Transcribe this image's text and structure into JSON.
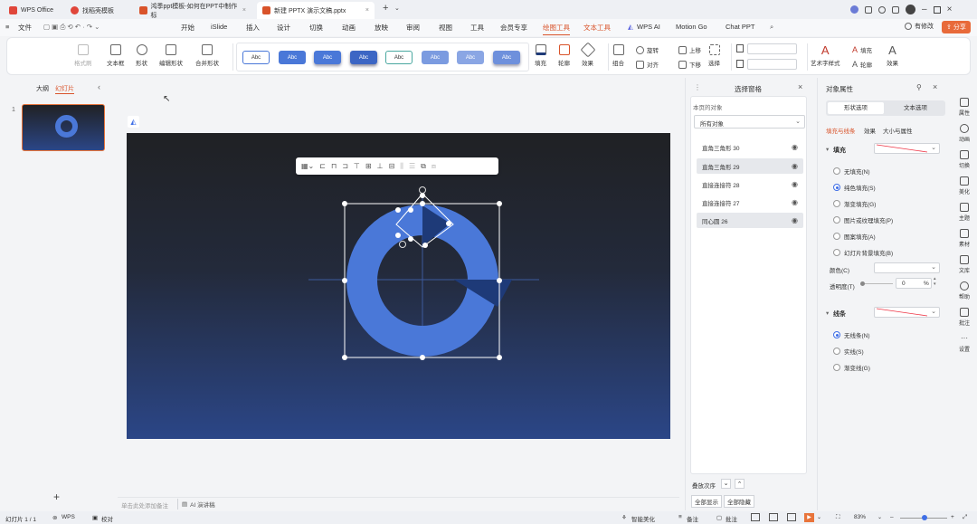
{
  "titlebar": {
    "tabs": [
      {
        "label": "WPS Office",
        "color": "#e0463a"
      },
      {
        "label": "找稻壳模板",
        "color": "#e0463a"
      },
      {
        "label": "鸿季ppt模板-如何在PPT中制作标",
        "color": "#d9532a"
      },
      {
        "label": "新建 PPTX 演示文稿.pptx",
        "color": "#d9532a"
      }
    ],
    "new_tab": "+",
    "user_status": "有修改",
    "share_label": "分享"
  },
  "menubar": {
    "file_label": "文件",
    "items": [
      "开始",
      "iSlide",
      "插入",
      "设计",
      "切换",
      "动画",
      "放映",
      "审阅",
      "视图",
      "工具",
      "会员专享",
      "绘图工具",
      "文本工具",
      "WPS AI",
      "Motion Go",
      "Chat PPT"
    ],
    "active_index": 11,
    "orange_index": 12
  },
  "ribbon": {
    "format_painter": "格式刷",
    "textbox": "文本框",
    "shape": "形状",
    "edit_shape": "编辑形状",
    "merge_shape": "合并形状",
    "style_label": "Abc",
    "fill": "填充",
    "outline": "轮廓",
    "effect": "效果",
    "rotate": "旋转",
    "align": "对齐",
    "group": "组合",
    "bring_up": "上移",
    "send_down": "下移",
    "select": "选择",
    "art_text": "艺术字样式",
    "text_fill": "填充",
    "text_outline": "轮廓",
    "text_effect": "效果"
  },
  "leftpanel": {
    "tab_outline": "大纲",
    "tab_slides": "幻灯片",
    "slide_number": "1",
    "add": "+"
  },
  "notes": {
    "placeholder": "单击此处添加备注",
    "ai_label": "AI 演讲稿"
  },
  "selection_pane": {
    "title": "选择窗格",
    "section_label": "本页的对象",
    "filter_value": "所有对象",
    "objects": [
      {
        "name": "直角三角形 30",
        "selected": false
      },
      {
        "name": "直角三角形 29",
        "selected": true
      },
      {
        "name": "直接连接符 28",
        "selected": false
      },
      {
        "name": "直接连接符 27",
        "selected": false
      },
      {
        "name": "同心圆 26",
        "selected": true
      }
    ],
    "order_label": "叠放次序",
    "show_all": "全部显示",
    "hide_all": "全部隐藏"
  },
  "props_pane": {
    "title": "对象属性",
    "tab_shape": "形状选项",
    "tab_text": "文本选项",
    "subtab_fill_line": "填充与线条",
    "subtab_effect": "效果",
    "subtab_size": "大小与属性",
    "fill_section": "填充",
    "fill_options": [
      "无填充(N)",
      "纯色填充(S)",
      "渐变填充(G)",
      "图片或纹理填充(P)",
      "图案填充(A)",
      "幻灯片背景填充(B)"
    ],
    "fill_selected": 1,
    "color_label": "颜色(C)",
    "transparency_label": "透明度(T)",
    "transparency_value": "0",
    "transparency_unit": "%",
    "line_section": "线条",
    "line_options": [
      "无线条(N)",
      "实线(S)",
      "渐变线(G)"
    ],
    "line_selected": 0
  },
  "rail": {
    "items": [
      "属性",
      "动画",
      "切换",
      "美化",
      "主题",
      "素材",
      "文库",
      "帮助",
      "批注",
      "设置"
    ]
  },
  "statusbar": {
    "slide_info": "幻灯片 1 / 1",
    "wps": "WPS",
    "proof": "校对",
    "beautify": "智能美化",
    "notes": "备注",
    "comment": "批注",
    "zoom": "83%"
  },
  "colors": {
    "accent": "#d9532a",
    "ring": "#4a78d8",
    "dark_blue": "#1e3a78",
    "select_blue": "#3e6ee6"
  }
}
